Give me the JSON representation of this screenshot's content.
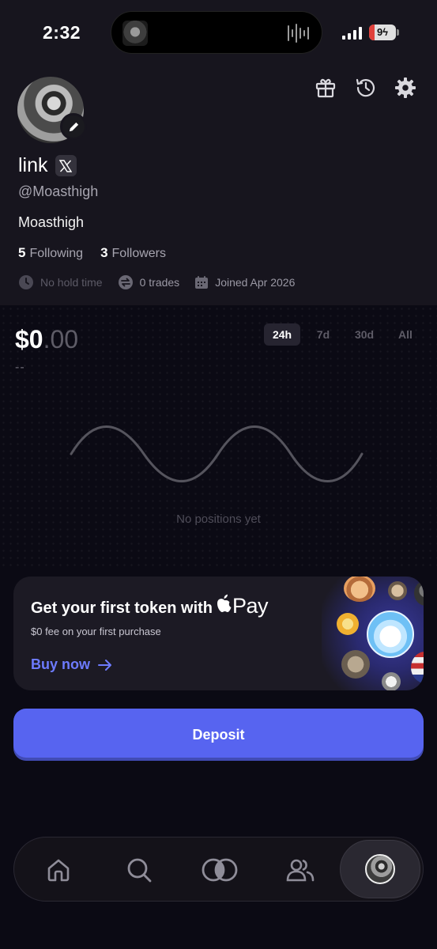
{
  "status_bar": {
    "time": "2:32",
    "battery": "9"
  },
  "profile": {
    "name": "link",
    "handle": "@Moasthigh",
    "bio": "Moasthigh",
    "following_count": "5",
    "following_label": "Following",
    "followers_count": "3",
    "followers_label": "Followers",
    "hold_time": "No hold time",
    "trades": "0 trades",
    "joined": "Joined Apr 2026",
    "icons": [
      "gift-icon",
      "history-icon",
      "gear-icon",
      "edit-icon",
      "x-logo-icon"
    ]
  },
  "portfolio": {
    "balance_main": "$0",
    "balance_cents": ".00",
    "change": "--",
    "ranges": [
      "24h",
      "7d",
      "30d",
      "All"
    ],
    "selected_range": "24h",
    "empty_text": "No positions yet"
  },
  "promo": {
    "title": "Get your first token with",
    "pay_brand": "Pay",
    "subtitle": "$0 fee on your first purchase",
    "cta": "Buy now"
  },
  "deposit_label": "Deposit",
  "nav": {
    "items": [
      "home-icon",
      "search-icon",
      "trade-icon",
      "community-icon",
      "profile-avatar"
    ],
    "active": "profile-avatar"
  },
  "colors": {
    "accent": "#5764f0",
    "cta_text": "#6d7bff",
    "background": "#0b0a14",
    "panel": "#17151e"
  }
}
